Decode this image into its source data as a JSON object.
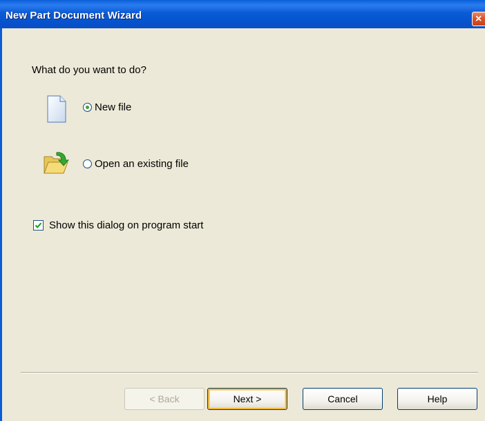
{
  "window": {
    "title": "New Part Document Wizard",
    "close_icon": "close-icon"
  },
  "prompt": "What do you want to do?",
  "options": [
    {
      "label": "New file",
      "selected": true,
      "icon": "new-document-icon"
    },
    {
      "label": "Open an existing file",
      "selected": false,
      "icon": "open-folder-icon"
    }
  ],
  "show_on_start": {
    "label": "Show this dialog on program start",
    "checked": true
  },
  "buttons": {
    "back": "< Back",
    "next": "Next >",
    "cancel": "Cancel",
    "help": "Help"
  },
  "colors": {
    "titlebar": "#0b5bd6",
    "dialog_bg": "#ece9d8",
    "radio_dot": "#3fa03f",
    "checkmark": "#21a121",
    "close_button": "#d9542b"
  }
}
